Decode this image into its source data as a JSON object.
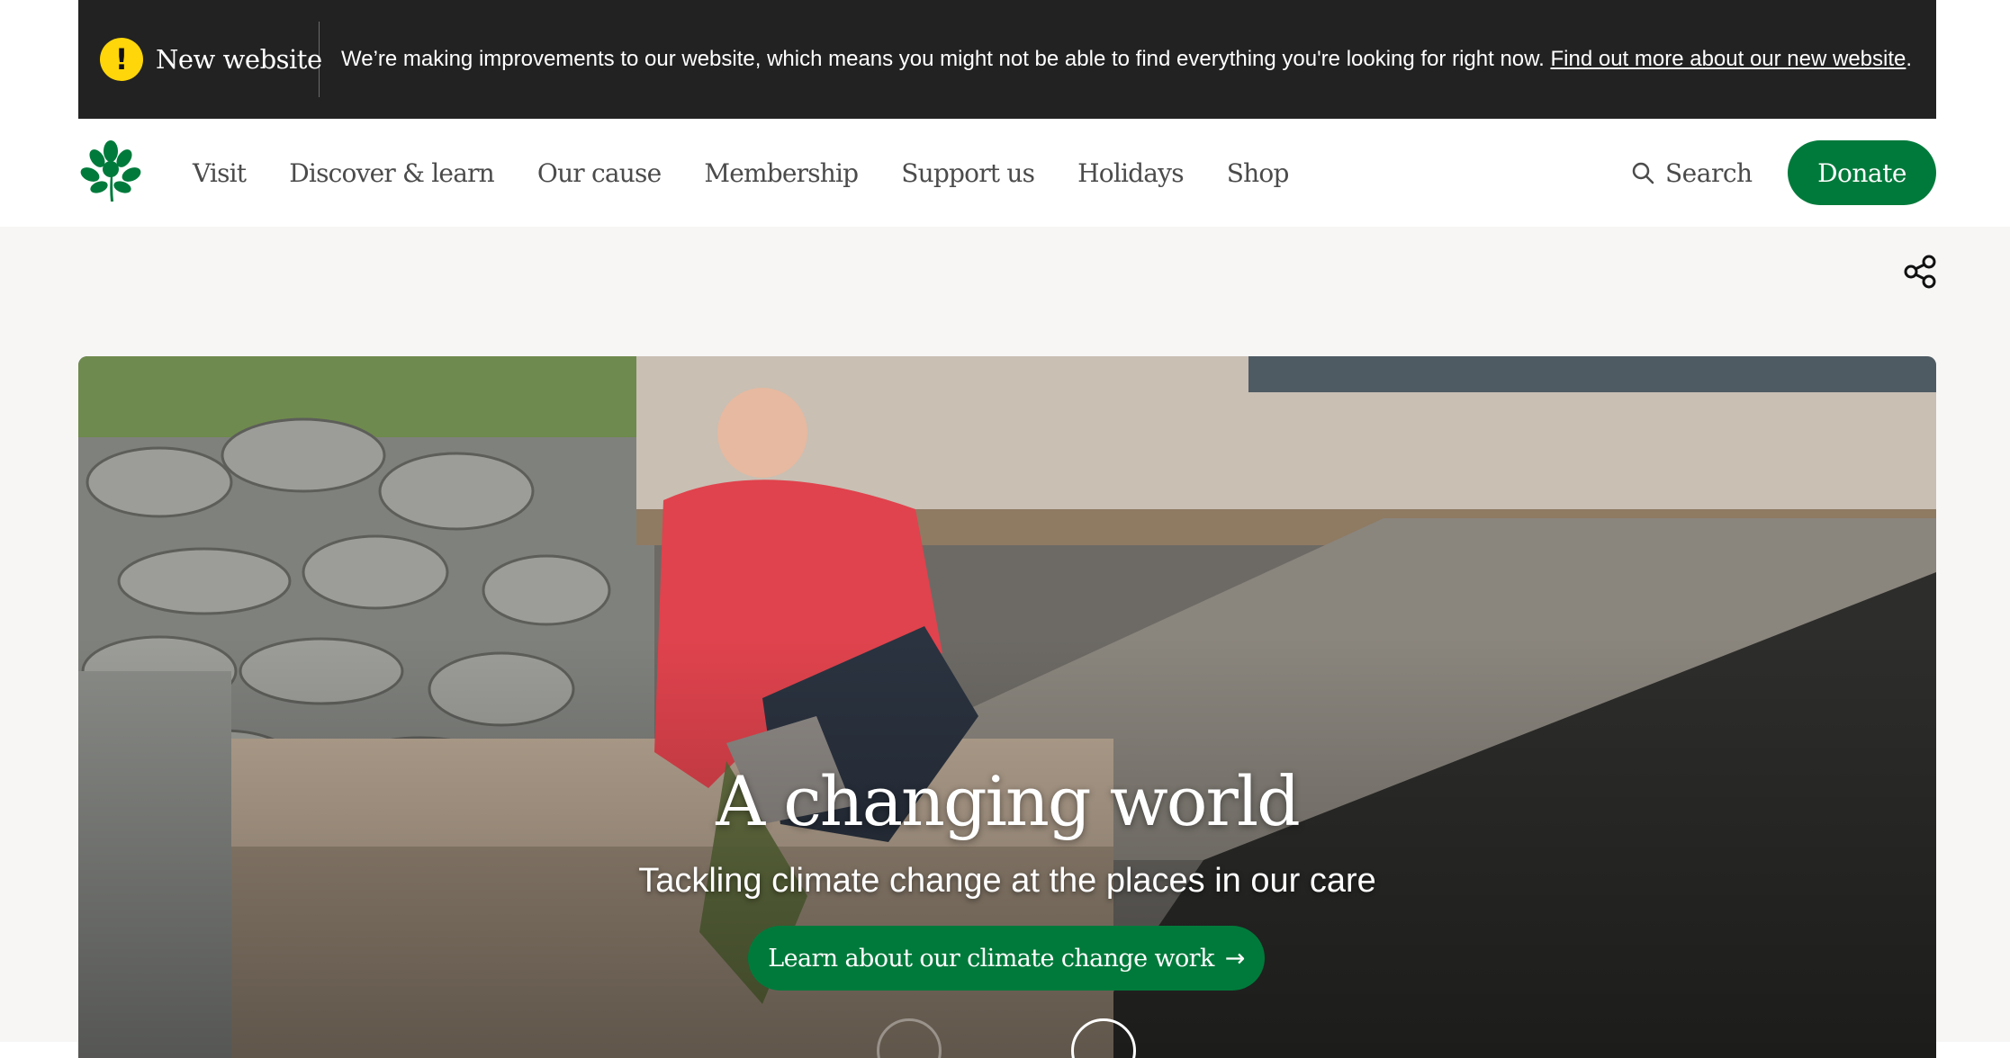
{
  "banner": {
    "badge_label": "New website",
    "message": "We’re making improvements to our website, which means you might not be able to find everything you're looking for right now. ",
    "link_text": "Find out more about our new website",
    "trailing": ".",
    "icon": "warning-icon",
    "background": "#222222",
    "badge_color": "#ffd60a"
  },
  "header": {
    "logo": "oak-leaf-logo",
    "nav": [
      "Visit",
      "Discover & learn",
      "Our cause",
      "Membership",
      "Support us",
      "Holidays",
      "Shop"
    ],
    "search_label": "Search",
    "search_icon": "search-icon",
    "donate_label": "Donate",
    "brand_color": "#007a3b"
  },
  "page": {
    "share_icon": "share-icon"
  },
  "hero": {
    "title": "A changing world",
    "subtitle": "Tackling climate change at the places in our care",
    "cta_label": "Learn about our climate change work",
    "cta_icon": "arrow-right-icon",
    "cta_arrow": "→",
    "carousel_prev_icon": "chevron-left-icon",
    "carousel_next_icon": "chevron-right-icon"
  }
}
